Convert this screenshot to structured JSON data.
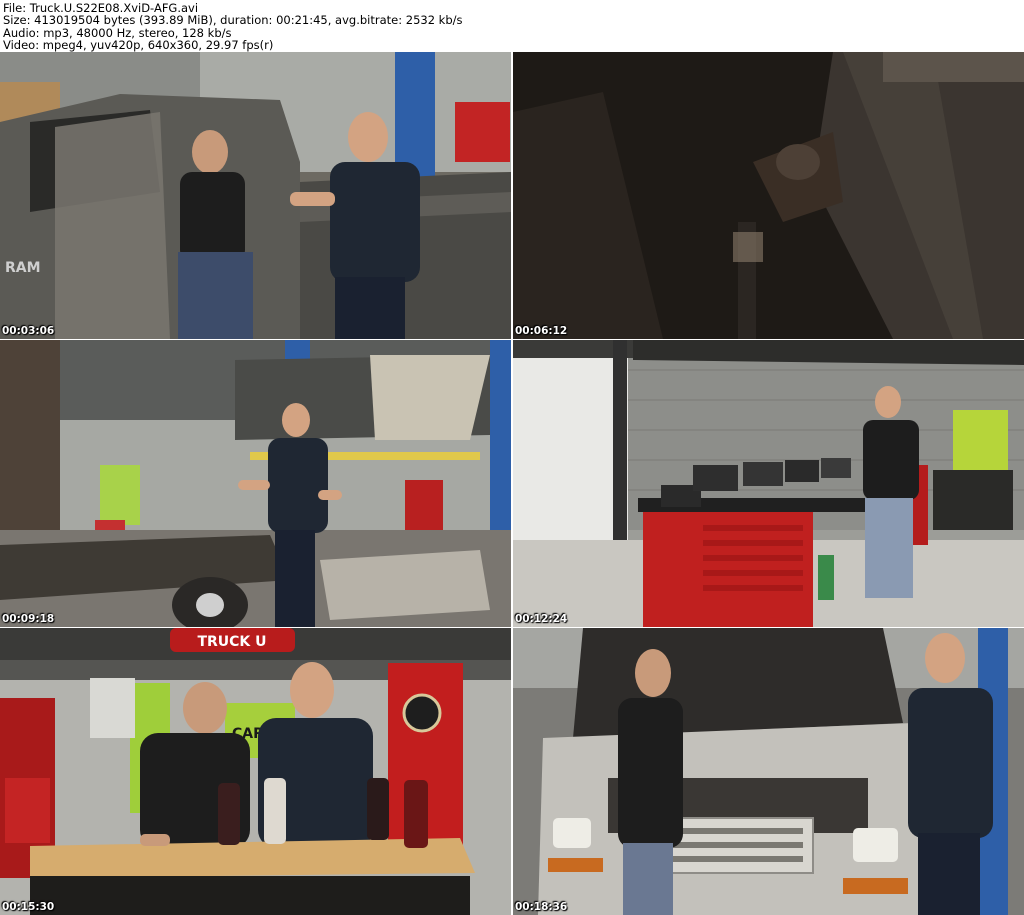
{
  "header": {
    "line1": "File: Truck.U.S22E08.XviD-AFG.avi",
    "line2": "Size: 413019504 bytes (393.89 MiB), duration: 00:21:45, avg.bitrate: 2532 kb/s",
    "line3": "Audio: mp3, 48000 Hz, stereo, 128 kb/s",
    "line4": "Video: mpeg4, yuv420p, 640x360, 29.97 fps(r)"
  },
  "thumbnails": [
    {
      "timestamp": "00:03:06"
    },
    {
      "timestamp": "00:06:12"
    },
    {
      "timestamp": "00:09:18"
    },
    {
      "timestamp": "00:12:24"
    },
    {
      "timestamp": "00:15:30"
    },
    {
      "timestamp": "00:18:36"
    }
  ],
  "signage": {
    "ram_badge": "RAM",
    "truck_sign": "TRUCK U",
    "carli_banner": "CARLI"
  }
}
